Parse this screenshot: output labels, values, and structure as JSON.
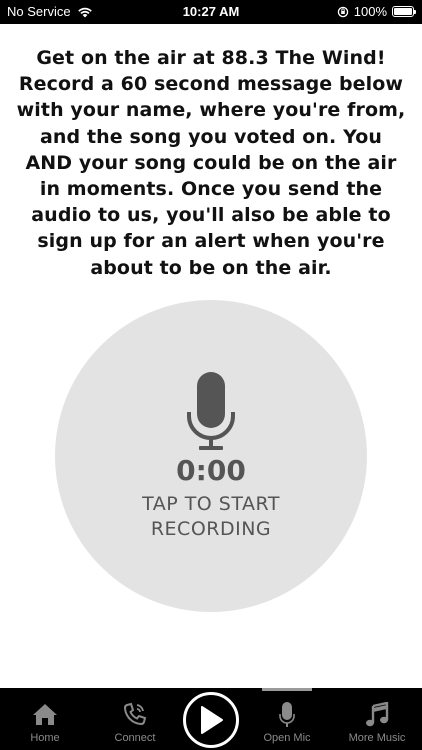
{
  "status_bar": {
    "carrier": "No Service",
    "time": "10:27 AM",
    "battery": "100%",
    "battery_level": 1.0
  },
  "content": {
    "message": "Get on the air at 88.3 The Wind! Record a 60 second message below with your name, where you're from, and the song you voted on. You AND your song could be on the air in moments. Once you send the audio to us, you'll also be able to sign up for an alert when you're about to be on the air."
  },
  "recorder": {
    "timer": "0:00",
    "instruction_line1": "TAP TO START",
    "instruction_line2": "RECORDING"
  },
  "tab_bar": {
    "tabs": [
      {
        "label": "Home",
        "icon": "home-icon"
      },
      {
        "label": "Connect",
        "icon": "phone-icon"
      },
      {
        "label": "Open Mic",
        "icon": "microphone-icon",
        "active": true
      },
      {
        "label": "More Music",
        "icon": "music-note-icon"
      }
    ],
    "play_icon": "play-icon"
  },
  "colors": {
    "background": "#ffffff",
    "circle": "#e3e3e3",
    "bar": "#000000",
    "tab_inactive": "#8a8a8a"
  }
}
